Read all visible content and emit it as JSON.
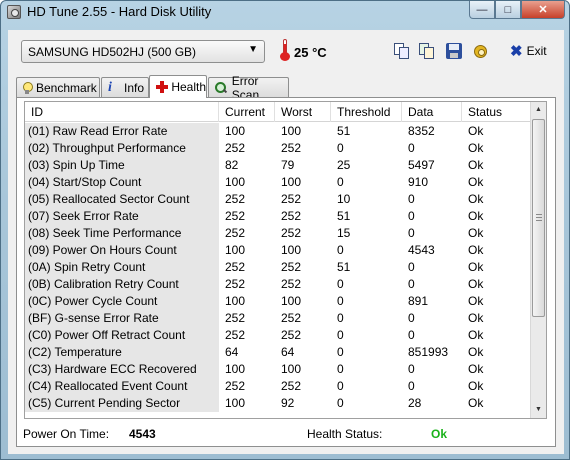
{
  "window": {
    "title": "HD Tune 2.55 - Hard Disk Utility"
  },
  "toolbar": {
    "drive": "SAMSUNG HD502HJ (500 GB)",
    "temperature": "25 °C",
    "exit_label": "Exit"
  },
  "tabs": [
    {
      "label": "Benchmark"
    },
    {
      "label": "Info"
    },
    {
      "label": "Health"
    },
    {
      "label": "Error Scan"
    }
  ],
  "active_tab": "Health",
  "table": {
    "columns": [
      "ID",
      "Current",
      "Worst",
      "Threshold",
      "Data",
      "Status"
    ],
    "rows": [
      [
        "(01) Raw Read Error Rate",
        "100",
        "100",
        "51",
        "8352",
        "Ok"
      ],
      [
        "(02) Throughput Performance",
        "252",
        "252",
        "0",
        "0",
        "Ok"
      ],
      [
        "(03) Spin Up Time",
        "82",
        "79",
        "25",
        "5497",
        "Ok"
      ],
      [
        "(04) Start/Stop Count",
        "100",
        "100",
        "0",
        "910",
        "Ok"
      ],
      [
        "(05) Reallocated Sector Count",
        "252",
        "252",
        "10",
        "0",
        "Ok"
      ],
      [
        "(07) Seek Error Rate",
        "252",
        "252",
        "51",
        "0",
        "Ok"
      ],
      [
        "(08) Seek Time Performance",
        "252",
        "252",
        "15",
        "0",
        "Ok"
      ],
      [
        "(09) Power On Hours Count",
        "100",
        "100",
        "0",
        "4543",
        "Ok"
      ],
      [
        "(0A) Spin Retry Count",
        "252",
        "252",
        "51",
        "0",
        "Ok"
      ],
      [
        "(0B) Calibration Retry Count",
        "252",
        "252",
        "0",
        "0",
        "Ok"
      ],
      [
        "(0C) Power Cycle Count",
        "100",
        "100",
        "0",
        "891",
        "Ok"
      ],
      [
        "(BF) G-sense Error Rate",
        "252",
        "252",
        "0",
        "0",
        "Ok"
      ],
      [
        "(C0) Power Off Retract Count",
        "252",
        "252",
        "0",
        "0",
        "Ok"
      ],
      [
        "(C2) Temperature",
        "64",
        "64",
        "0",
        "851993",
        "Ok"
      ],
      [
        "(C3) Hardware ECC Recovered",
        "100",
        "100",
        "0",
        "0",
        "Ok"
      ],
      [
        "(C4) Reallocated Event Count",
        "252",
        "252",
        "0",
        "0",
        "Ok"
      ],
      [
        "(C5) Current Pending Sector",
        "100",
        "92",
        "0",
        "28",
        "Ok"
      ]
    ]
  },
  "footer": {
    "power_on_label": "Power On Time:",
    "power_on_value": "4543",
    "health_label": "Health Status:",
    "health_value": "Ok"
  },
  "colors": {
    "health_ok": "#1bb21b",
    "id_column_bg": "#e6e6e6"
  },
  "icons": {
    "app": "hd-tune-icon",
    "temperature": "thermometer-icon",
    "tools": [
      "copy-text-icon",
      "copy-screen-icon",
      "save-icon",
      "options-icon",
      "exit-icon"
    ],
    "tabs": [
      "bulb-icon",
      "info-icon",
      "health-cross-icon",
      "magnifier-icon"
    ]
  }
}
